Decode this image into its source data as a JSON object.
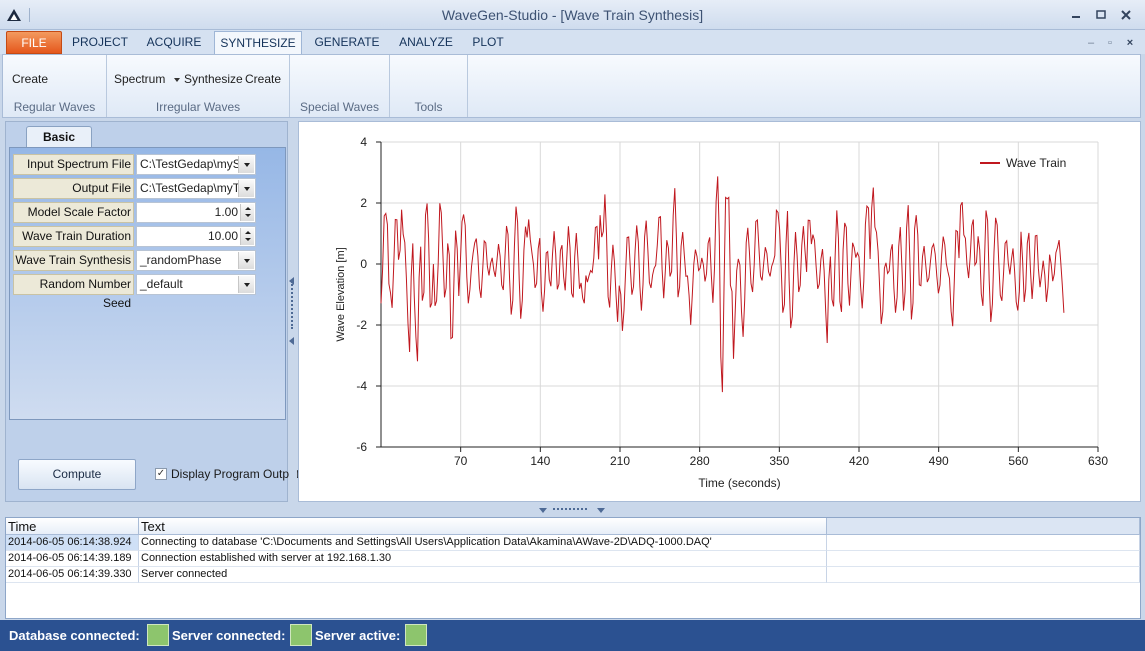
{
  "window": {
    "title": "WaveGen-Studio - [Wave Train Synthesis]"
  },
  "ribbon": {
    "tabs": [
      "FILE",
      "PROJECT",
      "ACQUIRE",
      "SYNTHESIZE",
      "GENERATE",
      "ANALYZE",
      "PLOT"
    ],
    "active_tab": "SYNTHESIZE",
    "groups": {
      "regular": {
        "label": "Regular Waves",
        "buttons": [
          "Create"
        ]
      },
      "irregular": {
        "label": "Irregular Waves",
        "buttons": [
          "Spectrum",
          "Synthesize",
          "Create"
        ]
      },
      "special": {
        "label": "Special Waves"
      },
      "tools": {
        "label": "Tools"
      }
    },
    "colors": {
      "file_tab": "#e5571c"
    }
  },
  "panel": {
    "tab": "Basic",
    "properties": [
      {
        "label": "Input Spectrum File",
        "value": "C:\\TestGedap\\myS",
        "control": "dropdown"
      },
      {
        "label": "Output File",
        "value": "C:\\TestGedap\\myTr",
        "control": "dropdown"
      },
      {
        "label": "Model Scale Factor",
        "value": "1.00",
        "control": "spinner"
      },
      {
        "label": "Wave Train Duration",
        "value": "10.00",
        "control": "spinner"
      },
      {
        "label": "Wave Train Synthesis",
        "value": "_randomPhase",
        "control": "dropdown"
      },
      {
        "label": "Random Number Seed",
        "value": "_default",
        "control": "dropdown"
      }
    ],
    "compute_label": "Compute",
    "display_output": {
      "label": "Display Program Output",
      "checked": true
    }
  },
  "chart_data": {
    "type": "line",
    "xlabel": "Time (seconds)",
    "ylabel": "Wave Elevation [m]",
    "xlim": [
      0,
      630
    ],
    "ylim": [
      -6,
      4
    ],
    "xticks": [
      70,
      140,
      210,
      280,
      350,
      420,
      490,
      560,
      630
    ],
    "yticks": [
      4,
      2,
      0,
      -2,
      -4,
      -6
    ],
    "grid": true,
    "legend_position": "top-right",
    "series": [
      {
        "name": "Wave Train",
        "color": "#c0181f",
        "x_range": [
          0,
          600
        ],
        "samples": 430,
        "peaks": [
          {
            "x": 3,
            "y": 1.6
          },
          {
            "x": 8,
            "y": -0.9
          },
          {
            "x": 18,
            "y": 1.8
          },
          {
            "x": 25,
            "y": -2.9
          },
          {
            "x": 32,
            "y": -3.2
          },
          {
            "x": 40,
            "y": 2.0
          },
          {
            "x": 48,
            "y": -1.7
          },
          {
            "x": 52,
            "y": 2.1
          },
          {
            "x": 62,
            "y": -2.8
          },
          {
            "x": 71,
            "y": 1.4
          },
          {
            "x": 130,
            "y": 1.5
          },
          {
            "x": 142,
            "y": -1.6
          },
          {
            "x": 178,
            "y": -1.6
          },
          {
            "x": 193,
            "y": 1.9
          },
          {
            "x": 208,
            "y": -1.9
          },
          {
            "x": 212,
            "y": -2.2
          },
          {
            "x": 245,
            "y": 1.7
          },
          {
            "x": 258,
            "y": 2.5
          },
          {
            "x": 272,
            "y": -2.0
          },
          {
            "x": 296,
            "y": 2.9
          },
          {
            "x": 300,
            "y": -4.2
          },
          {
            "x": 305,
            "y": 2.8
          },
          {
            "x": 310,
            "y": -3.2
          },
          {
            "x": 318,
            "y": -2.4
          },
          {
            "x": 330,
            "y": 1.6
          },
          {
            "x": 348,
            "y": 2.0
          },
          {
            "x": 360,
            "y": -2.1
          },
          {
            "x": 376,
            "y": 1.9
          },
          {
            "x": 392,
            "y": -2.6
          },
          {
            "x": 408,
            "y": 1.3
          },
          {
            "x": 428,
            "y": 1.9
          },
          {
            "x": 432,
            "y": 2.9
          },
          {
            "x": 440,
            "y": -2.1
          },
          {
            "x": 452,
            "y": -1.6
          },
          {
            "x": 470,
            "y": 1.6
          },
          {
            "x": 502,
            "y": -2.1
          },
          {
            "x": 510,
            "y": 2.6
          },
          {
            "x": 520,
            "y": 1.6
          },
          {
            "x": 560,
            "y": -1.6
          },
          {
            "x": 585,
            "y": -1.3
          },
          {
            "x": 596,
            "y": 0.8
          },
          {
            "x": 600,
            "y": -1.6
          }
        ]
      }
    ]
  },
  "log": {
    "headers": [
      "Time",
      "Text",
      ""
    ],
    "rows": [
      {
        "time": "2014-06-05 06:14:38.924",
        "text": "Connecting to database 'C:\\Documents and Settings\\All Users\\Application Data\\Akamina\\AWave-2D\\ADQ-1000.DAQ'"
      },
      {
        "time": "2014-06-05 06:14:39.189",
        "text": "Connection established with server at 192.168.1.30"
      },
      {
        "time": "2014-06-05 06:14:39.330",
        "text": "Server connected"
      }
    ]
  },
  "status": {
    "items": [
      {
        "label": "Database connected:",
        "color": "#8dc56d"
      },
      {
        "label": "Server connected:",
        "color": "#8dc56d"
      },
      {
        "label": "Server active:",
        "color": "#8dc56d"
      }
    ]
  },
  "icons": [
    "app-logo-icon",
    "minimize-icon",
    "restore-icon",
    "close-icon",
    "help-icon",
    "dropdown-arrow-icon",
    "spinner-icon",
    "checkbox-icon",
    "collapse-arrow-icon"
  ]
}
